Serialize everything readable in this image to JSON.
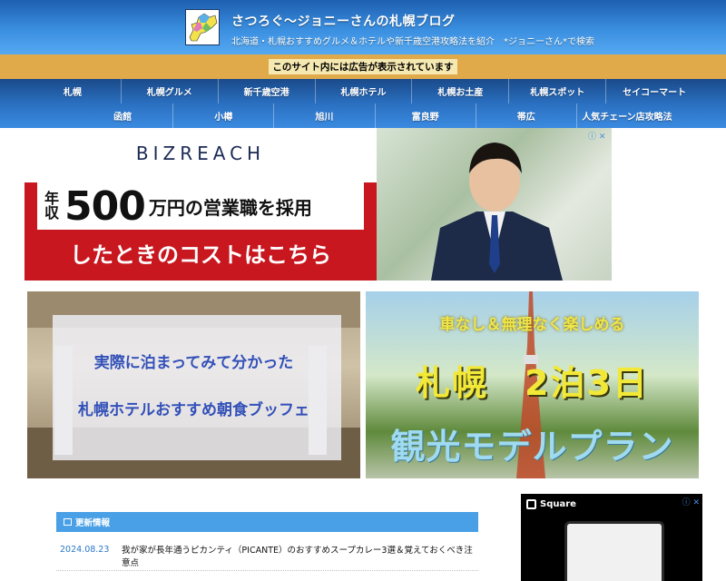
{
  "header": {
    "title": "さつろぐ〜ジョニーさんの札幌ブログ",
    "description": "北海道・札幌おすすめグルメ＆ホテルや新千歳空港攻略法を紹介　*ジョニーさん*で検索"
  },
  "ad_notice": "このサイト内には広告が表示されています",
  "nav": {
    "row1": [
      "札幌",
      "札幌グルメ",
      "新千歳空港",
      "札幌ホテル",
      "札幌お土産",
      "札幌スポット",
      "セイコーマート"
    ],
    "row2": [
      "函館",
      "小樽",
      "旭川",
      "富良野",
      "帯広",
      "人気チェーン店攻略法"
    ]
  },
  "banner_ad": {
    "brand": "BIZREACH",
    "nenshu": "年収",
    "amount": "500",
    "headline_rest": "万円の営業職を採用",
    "subline": "したときのコストはこちら",
    "info_icons": "ⓘ ✕"
  },
  "promo_left": {
    "line1": "実際に泊まってみて分かった",
    "line2": "札幌ホテルおすすめ朝食ブッフェ"
  },
  "promo_right": {
    "line1": "車なし＆無理なく楽しめる",
    "line2": "札幌　2泊3日",
    "line3": "観光モデルプラン"
  },
  "updates": {
    "heading": "更新情報",
    "items": [
      {
        "date": "2024.08.23",
        "title": "我が家が長年通うピカンティ（PICANTE）のおすすめスープカレー3選＆覚えておくべき注意点"
      }
    ]
  },
  "side_ad": {
    "brand": "Square",
    "close": "ⓘ ✕"
  }
}
